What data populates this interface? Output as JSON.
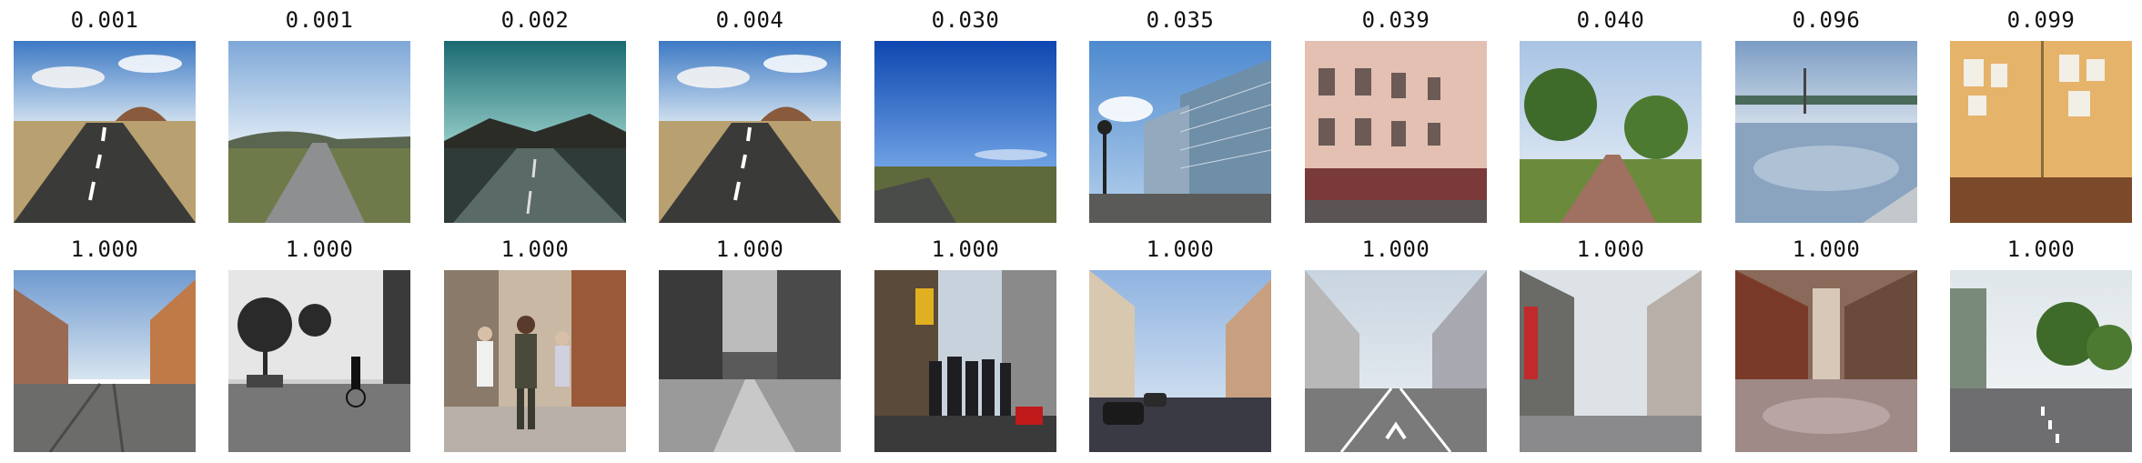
{
  "rows": [
    {
      "scores": [
        "0.001",
        "0.001",
        "0.002",
        "0.004",
        "0.030",
        "0.035",
        "0.039",
        "0.040",
        "0.096",
        "0.099"
      ],
      "images": [
        "photo-desert-road-volcano",
        "photo-road-to-horizon",
        "photo-teal-sky-road",
        "photo-desert-road-volcano-2",
        "photo-blue-sky-plain",
        "photo-glass-office-buildings",
        "photo-classic-building-facade",
        "photo-tree-lined-path",
        "photo-flooded-road",
        "photo-poster-wall"
      ]
    },
    {
      "scores": [
        "1.000",
        "1.000",
        "1.000",
        "1.000",
        "1.000",
        "1.000",
        "1.000",
        "1.000",
        "1.000",
        "1.000"
      ],
      "images": [
        "photo-street-tram-tracks",
        "photo-bw-street-cyclists",
        "photo-pedestrians-alley",
        "photo-bw-snowy-street",
        "photo-crowded-shopping-street",
        "photo-street-parked-cars",
        "photo-city-avenue-arrows",
        "photo-narrow-shop-street",
        "photo-wet-cobble-street",
        "photo-street-crossing-trees"
      ]
    }
  ]
}
